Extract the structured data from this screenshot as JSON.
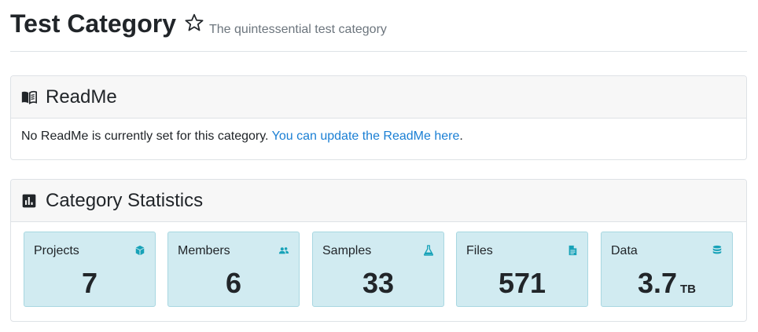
{
  "header": {
    "title": "Test Category",
    "subtitle": "The quintessential test category",
    "star_icon": "star-outline-icon"
  },
  "readme": {
    "title": "ReadMe",
    "icon": "book-open-icon",
    "text": "No ReadMe is currently set for this category.",
    "link_text": "You can update the ReadMe here",
    "trailing": ".",
    "link_color": "#1a7fd4"
  },
  "stats": {
    "title": "Category Statistics",
    "icon": "bar-chart-icon",
    "tile_color": "#d1ebf1",
    "icon_color": "#17a2b8",
    "tiles": [
      {
        "label": "Projects",
        "value": "7",
        "unit": "",
        "icon": "cube-icon"
      },
      {
        "label": "Members",
        "value": "6",
        "unit": "",
        "icon": "users-icon"
      },
      {
        "label": "Samples",
        "value": "33",
        "unit": "",
        "icon": "flask-icon"
      },
      {
        "label": "Files",
        "value": "571",
        "unit": "",
        "icon": "file-icon"
      },
      {
        "label": "Data",
        "value": "3.7",
        "unit": "TB",
        "icon": "database-icon"
      }
    ]
  }
}
